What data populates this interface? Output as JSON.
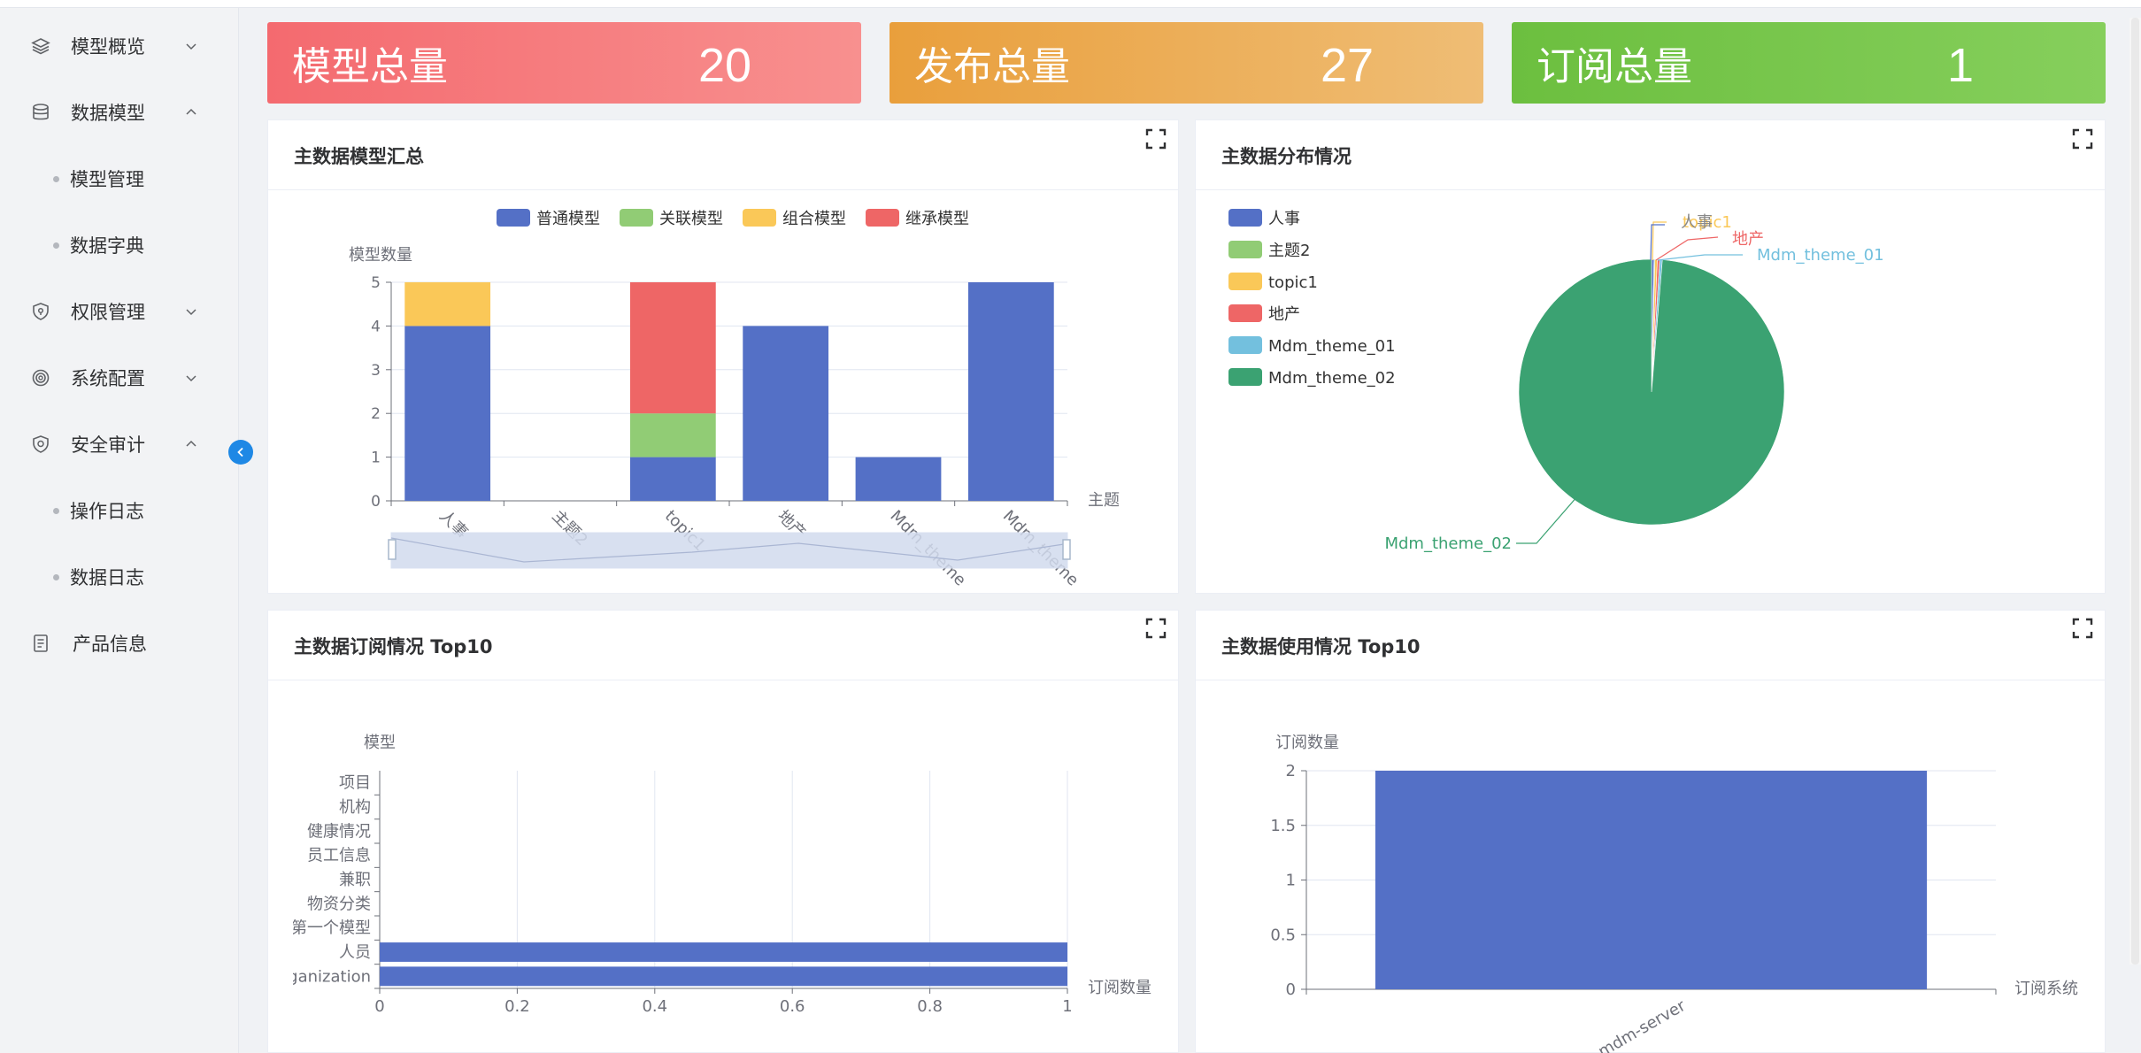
{
  "sidebar": {
    "items": [
      {
        "label": "模型概览",
        "icon": "layers-icon",
        "expanded": false
      },
      {
        "label": "数据模型",
        "icon": "database-icon",
        "expanded": true,
        "children": [
          "模型管理",
          "数据字典"
        ]
      },
      {
        "label": "权限管理",
        "icon": "shield-icon",
        "expanded": false
      },
      {
        "label": "系统配置",
        "icon": "settings-icon",
        "expanded": false
      },
      {
        "label": "安全审计",
        "icon": "shield-check-icon",
        "expanded": true,
        "children": [
          "操作日志",
          "数据日志"
        ]
      },
      {
        "label": "产品信息",
        "icon": "document-icon",
        "expanded": false
      }
    ]
  },
  "stats": [
    {
      "label": "模型总量",
      "value": "20"
    },
    {
      "label": "发布总量",
      "value": "27"
    },
    {
      "label": "订阅总量",
      "value": "1"
    }
  ],
  "panels": {
    "model_summary": {
      "title": "主数据模型汇总"
    },
    "distribution": {
      "title": "主数据分布情况"
    },
    "subscription": {
      "title": "主数据订阅情况 Top10"
    },
    "usage": {
      "title": "主数据使用情况 Top10"
    }
  },
  "colors": {
    "blue": "#5470c6",
    "green": "#91cc75",
    "yellow": "#fac858",
    "red": "#ee6666",
    "cyan": "#73c0de",
    "teal": "#3ba272",
    "accent": "#1e88e5"
  },
  "chart_data": [
    {
      "type": "bar",
      "stacked": true,
      "ylabel": "模型数量",
      "xlabel": "主题",
      "ylim": [
        0,
        5
      ],
      "yticks": [
        "0",
        "1",
        "2",
        "3",
        "4",
        "5"
      ],
      "categories": [
        "人事",
        "主题2",
        "topic1",
        "地产",
        "Mdm_theme",
        "Mdm_theme"
      ],
      "series": [
        {
          "name": "普通模型",
          "values": [
            4,
            0,
            1,
            4,
            1,
            5
          ]
        },
        {
          "name": "关联模型",
          "values": [
            0,
            0,
            1,
            0,
            0,
            0
          ]
        },
        {
          "name": "组合模型",
          "values": [
            1,
            0,
            0,
            0,
            0,
            0
          ]
        },
        {
          "name": "继承模型",
          "values": [
            0,
            0,
            3,
            0,
            0,
            0
          ]
        }
      ],
      "legend_position": "top"
    },
    {
      "type": "pie",
      "legend": [
        "人事",
        "主题2",
        "topic1",
        "地产",
        "Mdm_theme_01",
        "Mdm_theme_02"
      ],
      "slice_labels": [
        "人事",
        "topic1",
        "地产",
        "Mdm_theme_01",
        "Mdm_theme_02"
      ],
      "values": [
        0.3,
        0.1,
        0.3,
        0.3,
        0.3,
        98.7
      ],
      "legend_position": "left"
    },
    {
      "type": "bar",
      "orientation": "horizontal",
      "ylabel": "模型",
      "xlabel": "订阅数量",
      "xlim": [
        0,
        1
      ],
      "xticks": [
        "0",
        "0.2",
        "0.4",
        "0.6",
        "0.8",
        "1"
      ],
      "categories": [
        "ganization",
        "人员",
        "第一个模型",
        "物资分类",
        "兼职",
        "员工信息",
        "健康情况",
        "机构",
        "项目"
      ],
      "values": [
        1,
        1,
        0,
        0,
        0,
        0,
        0,
        0,
        0
      ]
    },
    {
      "type": "bar",
      "ylabel": "订阅数量",
      "xlabel": "订阅系统",
      "ylim": [
        0,
        2
      ],
      "yticks": [
        "0",
        "0.5",
        "1",
        "1.5",
        "2"
      ],
      "categories": [
        "mdm-server"
      ],
      "values": [
        2
      ]
    }
  ]
}
